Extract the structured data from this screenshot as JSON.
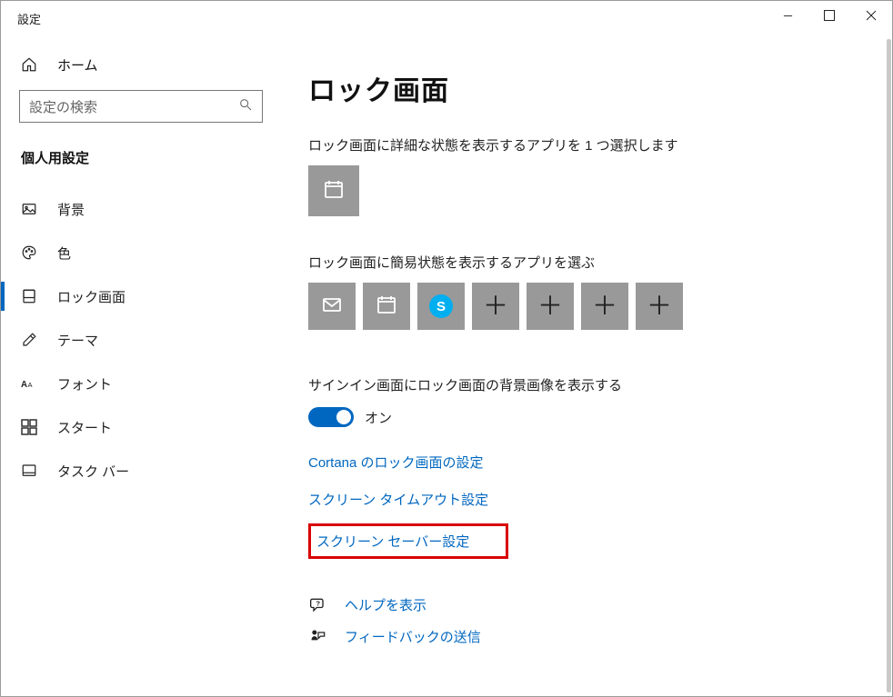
{
  "window_title": "設定",
  "home_label": "ホーム",
  "search": {
    "placeholder": "設定の検索"
  },
  "section_title": "個人用設定",
  "nav": [
    {
      "label": "背景",
      "icon": "image-icon"
    },
    {
      "label": "色",
      "icon": "palette-icon"
    },
    {
      "label": "ロック画面",
      "icon": "lock-screen-icon",
      "active": true
    },
    {
      "label": "テーマ",
      "icon": "theme-icon"
    },
    {
      "label": "フォント",
      "icon": "font-icon"
    },
    {
      "label": "スタート",
      "icon": "start-icon"
    },
    {
      "label": "タスク バー",
      "icon": "taskbar-icon"
    }
  ],
  "page_title": "ロック画面",
  "detail_section": {
    "heading": "ロック画面に詳細な状態を表示するアプリを 1 つ選択します",
    "tile_icon": "calendar-icon"
  },
  "quick_section": {
    "heading": "ロック画面に簡易状態を表示するアプリを選ぶ",
    "tiles": [
      {
        "kind": "icon",
        "name": "mail-icon"
      },
      {
        "kind": "icon",
        "name": "calendar-icon"
      },
      {
        "kind": "skype",
        "letter": "S"
      },
      {
        "kind": "plus"
      },
      {
        "kind": "plus"
      },
      {
        "kind": "plus"
      },
      {
        "kind": "plus"
      }
    ]
  },
  "toggle": {
    "label": "サインイン画面にロック画面の背景画像を表示する",
    "state_text": "オン",
    "on": true
  },
  "links": {
    "cortana": "Cortana のロック画面の設定",
    "timeout": "スクリーン タイムアウト設定",
    "screensaver": "スクリーン セーバー設定"
  },
  "help": {
    "help_label": "ヘルプを表示",
    "feedback_label": "フィードバックの送信"
  }
}
